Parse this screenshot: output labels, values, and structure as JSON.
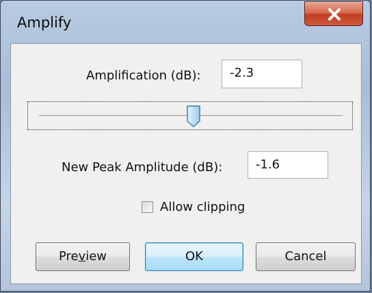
{
  "window": {
    "title": "Amplify"
  },
  "amplification": {
    "label": "Amplification (dB):",
    "value": "-2.3"
  },
  "slider": {
    "position": 0.51
  },
  "peak": {
    "label": "New Peak Amplitude (dB):",
    "value": "-1.6"
  },
  "clipping": {
    "label": "Allow clipping",
    "checked": false
  },
  "buttons": {
    "preview_pre": "Pre",
    "preview_u": "v",
    "preview_post": "iew",
    "ok": "OK",
    "cancel": "Cancel"
  },
  "colors": {
    "close_button": "#c13e23",
    "default_button": "#3c7fb1"
  }
}
